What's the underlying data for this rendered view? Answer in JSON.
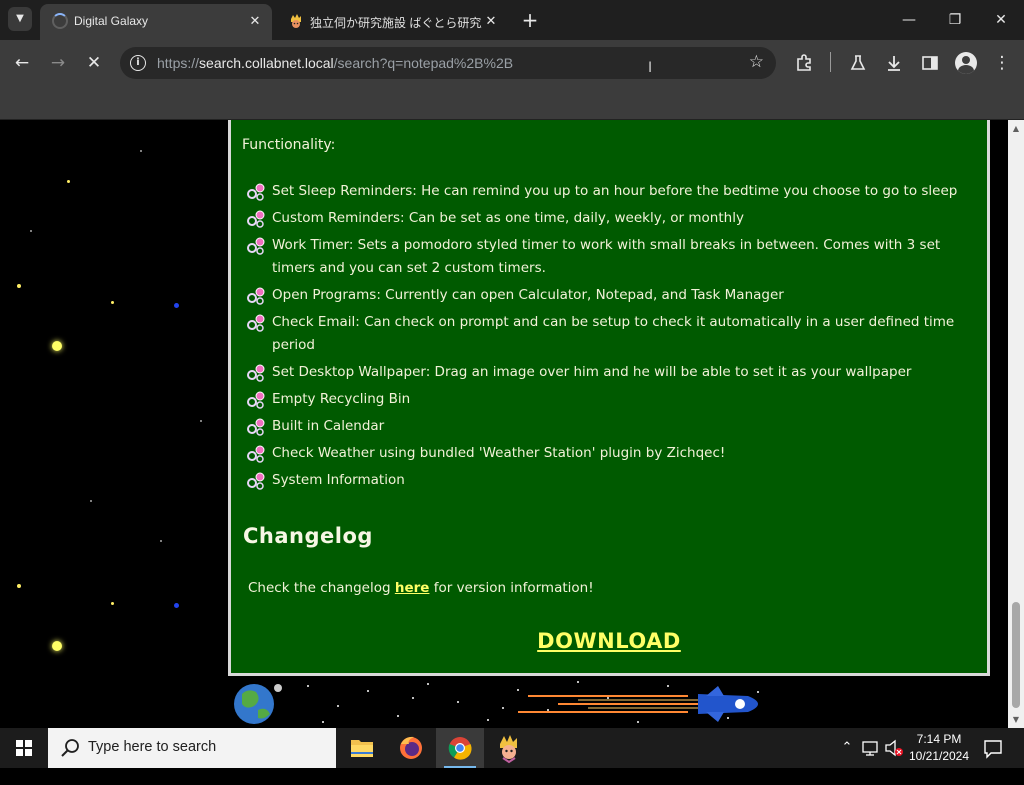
{
  "browser": {
    "tabs": [
      {
        "title": "Digital Galaxy",
        "state": "loading"
      },
      {
        "title": "独立伺か研究施設 ばぐとら研究所"
      }
    ],
    "new_tab_icon": "plus-icon",
    "address": {
      "scheme": "https://",
      "host": "search.collabnet.local",
      "path": "/search?q=notepad%2B%2B"
    },
    "window_controls": [
      "minimize-icon",
      "restore-icon",
      "close-icon"
    ]
  },
  "page": {
    "section_label": "Functionality:",
    "features": [
      "Set Sleep Reminders: He can remind you up to an hour before the bedtime you choose to go to sleep",
      "Custom Reminders: Can be set as one time, daily, weekly, or monthly",
      "Work Timer: Sets a pomodoro styled timer to work with small breaks in between. Comes with 3 set timers and you can set 2 custom timers.",
      "Open Programs: Currently can open Calculator, Notepad, and Task Manager",
      "Check Email: Can check on prompt and can be setup to check it automatically in a user defined time period",
      "Set Desktop Wallpaper: Drag an image over him and he will be able to set it as your wallpaper",
      "Empty Recycling Bin",
      "Built in Calendar",
      "Check Weather using bundled 'Weather Station' plugin by Zichqec!",
      "System Information"
    ],
    "changelog": {
      "heading": "Changelog",
      "text_before": "Check the changelog ",
      "link": "here",
      "text_after": " for version information!"
    },
    "download_label": "DOWNLOAD",
    "colors": {
      "panel": "#005a00",
      "text": "#f2f2d8",
      "link": "#ffff66"
    }
  },
  "taskbar": {
    "search_placeholder": "Type here to search",
    "apps": [
      "file-explorer-icon",
      "firefox-icon",
      "chrome-icon",
      "ghost-app-icon"
    ],
    "clock": {
      "time": "7:14 PM",
      "date": "10/21/2024"
    }
  }
}
